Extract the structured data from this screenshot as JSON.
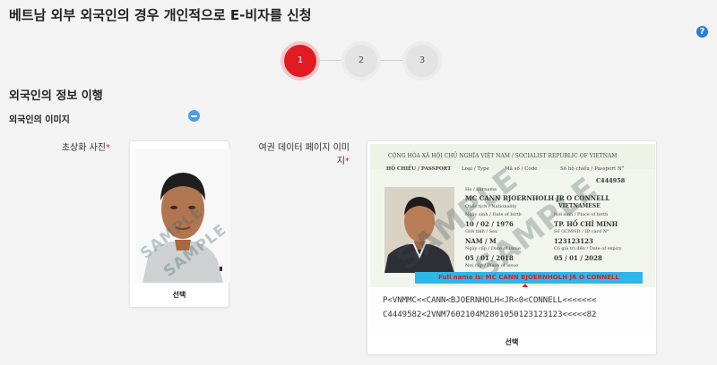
{
  "header": {
    "title": "베트남 외부 외국인의 경우 개인적으로 E-비자를 신청",
    "help_icon": "?"
  },
  "stepper": {
    "steps": [
      "1",
      "2",
      "3"
    ],
    "current": 1
  },
  "section": {
    "title": "외국인의 정보 이행",
    "subtitle": "외국인의 이미지"
  },
  "portrait": {
    "label": "초상화 사진",
    "required": "*",
    "watermark": "SAMPLE",
    "select_label": "선택"
  },
  "passport_upload": {
    "label_line1": "여권 데이터 페이지 이미",
    "label_line2": "지",
    "required": "*",
    "select_label": "선택",
    "sample_image": {
      "header": "CỘNG HÒA XÃ HỘI CHỦ NGHĨA VIỆT NAM / SOCIALIST REPUBLIC OF VIETNAM",
      "doc_type_label": "HỘ CHIẾU / PASSPORT",
      "type_label": "Loại / Type",
      "code_label": "Mã số / Code",
      "passport_no_label": "Số hộ chiếu / Passport N°",
      "passport_no": "C444958",
      "name": "MC CANN BJOERNHOLH JR O CONNELL",
      "nationality_label": "Quốc tịch / Nationality",
      "nationality": "VIETNAMESE",
      "dob_label": "Ngày sinh / Date of birth",
      "dob": "10 / 02 / 1976",
      "pob_label": "Nơi sinh / Place of birth",
      "pob": "TP. HỒ CHÍ MINH",
      "sex_label": "Giới tính / Sex",
      "id_label": "Số GCMND / ID card N°",
      "sex": "NAM / M",
      "id_no": "123123123",
      "issue_label": "Ngày cấp / Date of issue",
      "expiry_label": "Có giá trị đến / Date of expiry",
      "issue_date": "05 / 01 / 2018",
      "expiry_date": "05 / 01 / 2028",
      "poi_label": "Nơi cấp / Place of issue",
      "fullname_note": "Full name is: MC CANN BJOERNHOLH JR O CONNELL",
      "mrz_line1": "P<VNMMC<<CANN<BJOERNHOLH<JR<0<CONNELL<<<<<<<",
      "mrz_line2": "C4449582<2VNM7602104M2801050123123123<<<<<82",
      "watermark": "SAMPLE"
    }
  },
  "colors": {
    "accent": "#e21b23",
    "highlight": "#2fb6e8",
    "help": "#2a7ed3"
  }
}
